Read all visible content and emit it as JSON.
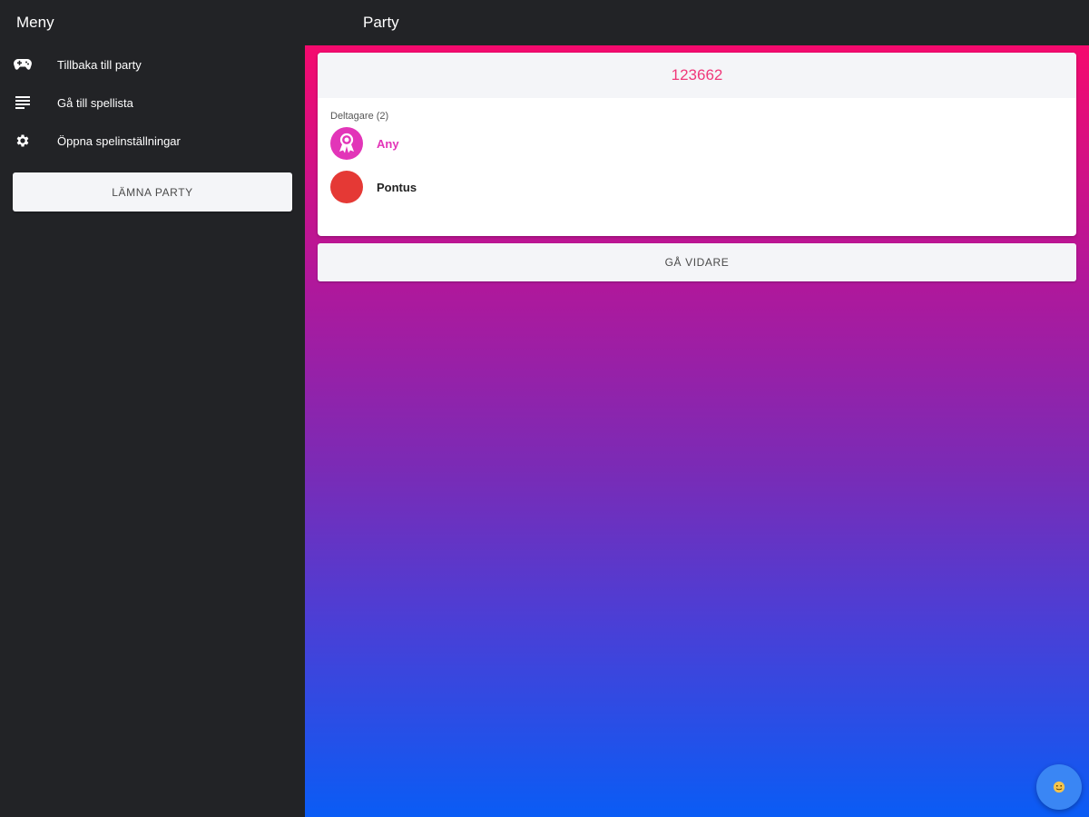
{
  "sidebar": {
    "title": "Meny",
    "items": [
      {
        "label": "Tillbaka till party",
        "icon": "gamepad-icon"
      },
      {
        "label": "Gå till spellista",
        "icon": "list-icon"
      },
      {
        "label": "Öppna spelinställningar",
        "icon": "gear-icon"
      }
    ],
    "leave_label": "LÄMNA PARTY"
  },
  "header": {
    "title": "Party"
  },
  "party": {
    "code": "123662",
    "participants_label": "Deltagare (2)",
    "participants": [
      {
        "name": "Any",
        "avatar_color": "#e235b8",
        "name_color": "#e235b8",
        "icon": "award-icon"
      },
      {
        "name": "Pontus",
        "avatar_color": "#e53935",
        "name_color": "#222222",
        "icon": ""
      }
    ],
    "next_label": "GÅ VIDARE"
  },
  "fab": {
    "icon": "smiley-icon"
  },
  "colors": {
    "accent": "#f0397a",
    "gradient_top": "#f50a6e",
    "gradient_bottom": "#0a5cf5",
    "sidebar_bg": "#222326"
  }
}
